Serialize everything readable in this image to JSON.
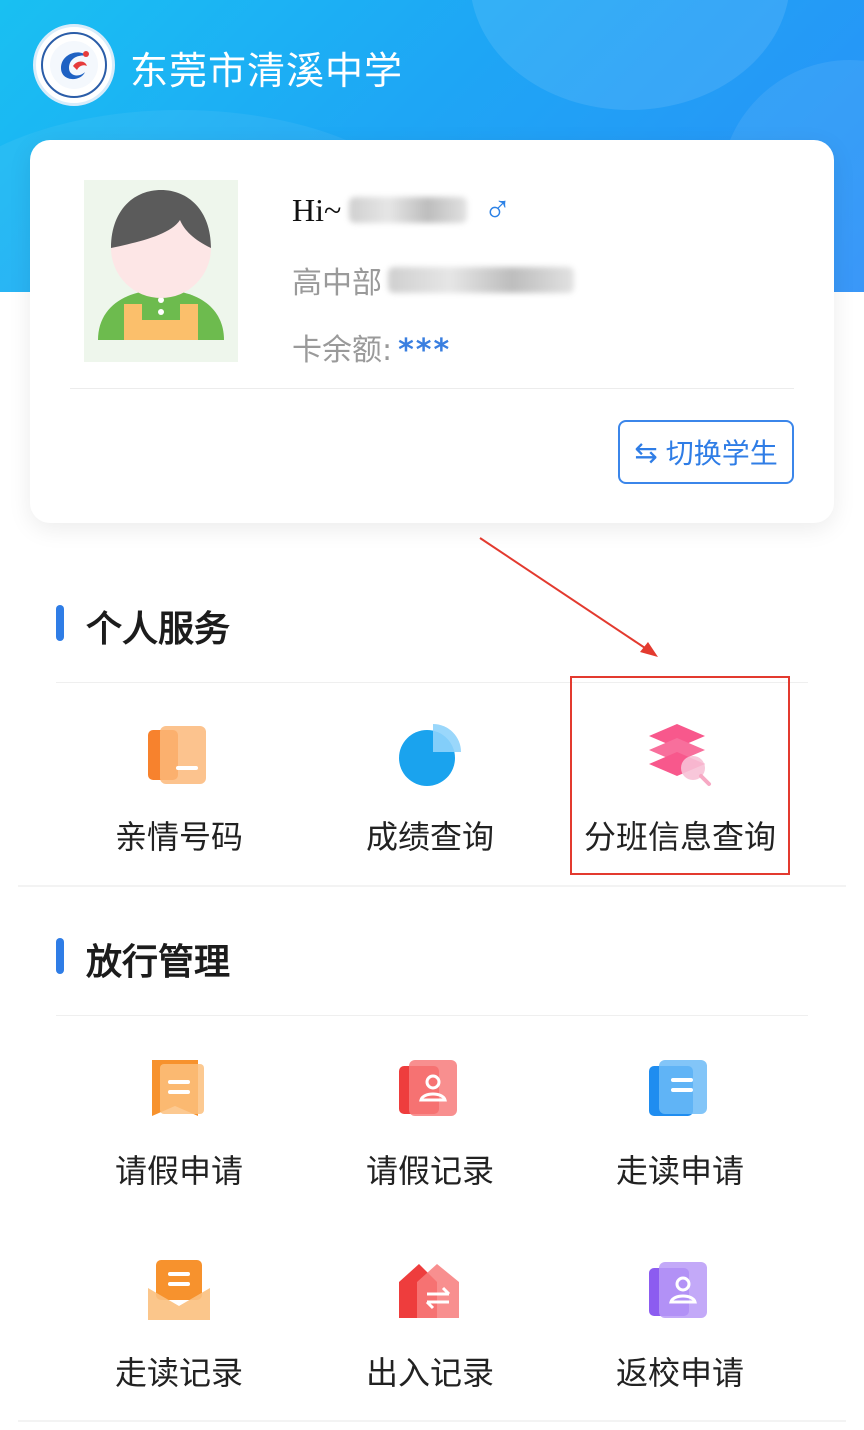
{
  "header": {
    "school_name": "东莞市清溪中学"
  },
  "profile": {
    "greeting": "Hi~",
    "department_prefix": "高中部",
    "balance_label": "卡余额:",
    "balance_value": "***",
    "switch_label": "切换学生"
  },
  "sections": {
    "personal": {
      "title": "个人服务",
      "items": [
        {
          "label": "亲情号码",
          "icon": "contact-book-icon",
          "color": "#f7822d"
        },
        {
          "label": "成绩查询",
          "icon": "pie-chart-icon",
          "color": "#1aa3ee"
        },
        {
          "label": "分班信息查询",
          "icon": "layers-search-icon",
          "color": "#f8588c"
        }
      ]
    },
    "release": {
      "title": "放行管理",
      "items": [
        {
          "label": "请假申请",
          "icon": "leave-request-icon",
          "color": "#f7922d"
        },
        {
          "label": "请假记录",
          "icon": "leave-record-icon",
          "color": "#ee3d3d"
        },
        {
          "label": "走读申请",
          "icon": "commute-request-icon",
          "color": "#1f8df0"
        },
        {
          "label": "走读记录",
          "icon": "commute-record-icon",
          "color": "#f7922d"
        },
        {
          "label": "出入记录",
          "icon": "entry-exit-icon",
          "color": "#ee3d3d"
        },
        {
          "label": "返校申请",
          "icon": "return-school-icon",
          "color": "#8c5cf0"
        }
      ]
    }
  },
  "colors": {
    "accent": "#2f7de6",
    "highlight": "#e33a2f"
  }
}
